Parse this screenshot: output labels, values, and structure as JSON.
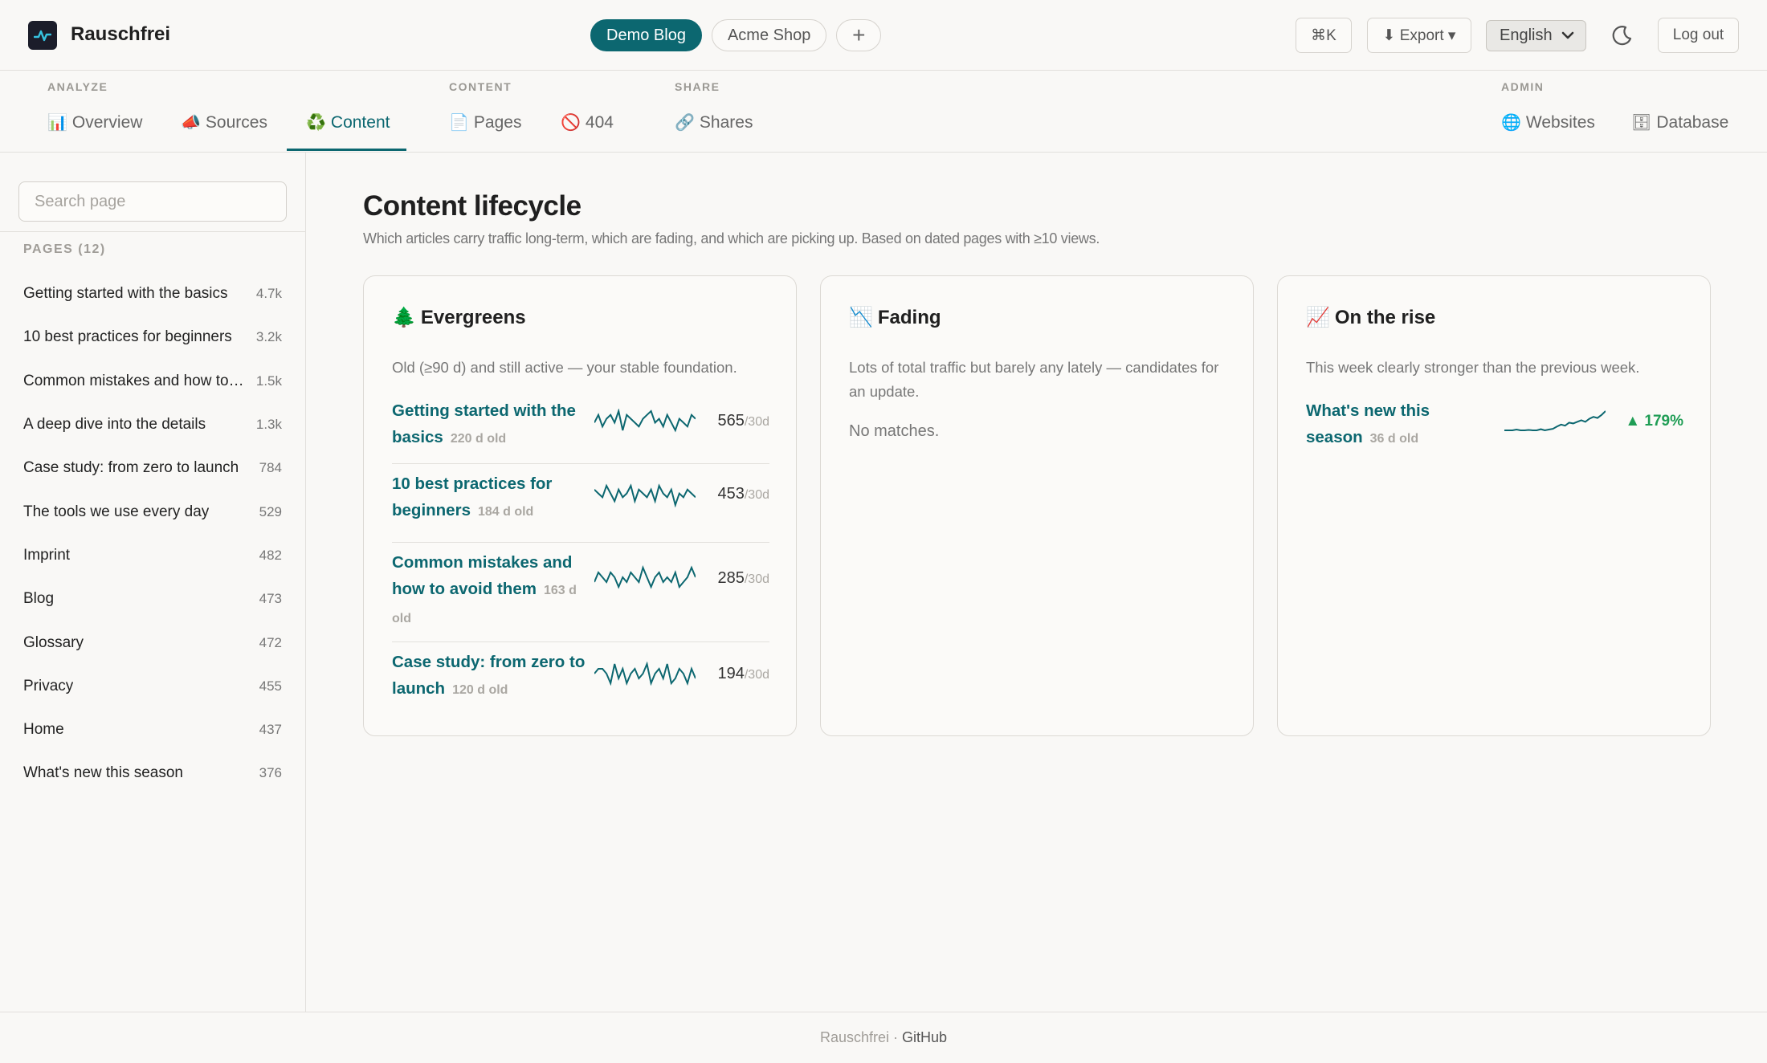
{
  "app": {
    "name": "Rauschfrei"
  },
  "workspaces": [
    {
      "label": "Demo Blog",
      "active": true
    },
    {
      "label": "Acme Shop",
      "active": false
    }
  ],
  "workspace_add": "+",
  "toolbar": {
    "command": "⌘K",
    "export": "⬇ Export ▾",
    "language": "English",
    "logout": "Log out"
  },
  "nav": {
    "groups": {
      "analyze": "ANALYZE",
      "content": "CONTENT",
      "share": "SHARE",
      "admin": "ADMIN"
    },
    "items": {
      "overview": {
        "icon": "📊",
        "label": "Overview"
      },
      "sources": {
        "icon": "📣",
        "label": "Sources"
      },
      "content": {
        "icon": "♻️",
        "label": "Content"
      },
      "pages": {
        "icon": "📄",
        "label": "Pages"
      },
      "notfound": {
        "icon": "🚫",
        "label": "404"
      },
      "shares": {
        "icon": "🔗",
        "label": "Shares"
      },
      "websites": {
        "icon": "🌐",
        "label": "Websites"
      },
      "database": {
        "icon": "🗄",
        "label": "Database"
      }
    },
    "active": "content"
  },
  "sidebar": {
    "search_placeholder": "Search page",
    "pages_label": "PAGES (12)",
    "pages": [
      {
        "title": "Getting started with the basics",
        "count": "4.7k"
      },
      {
        "title": "10 best practices for beginners",
        "count": "3.2k"
      },
      {
        "title": "Common mistakes and how to avoid them",
        "count": "1.5k"
      },
      {
        "title": "A deep dive into the details",
        "count": "1.3k"
      },
      {
        "title": "Case study: from zero to launch",
        "count": "784"
      },
      {
        "title": "The tools we use every day",
        "count": "529"
      },
      {
        "title": "Imprint",
        "count": "482"
      },
      {
        "title": "Blog",
        "count": "473"
      },
      {
        "title": "Glossary",
        "count": "472"
      },
      {
        "title": "Privacy",
        "count": "455"
      },
      {
        "title": "Home",
        "count": "437"
      },
      {
        "title": "What's new this season",
        "count": "376"
      }
    ]
  },
  "main": {
    "title": "Content lifecycle",
    "subtitle": "Which articles carry traffic long-term, which are fading, and which are picking up. Based on dated pages with ≥10 views."
  },
  "cards": {
    "evergreens": {
      "icon": "🌲",
      "title": "Evergreens",
      "desc": "Old (≥90 d) and still active — your stable foundation.",
      "rows": [
        {
          "title": "Getting started with the basics",
          "age": "220 d old",
          "views": "565",
          "per": "/30d",
          "spark": [
            4,
            6,
            3,
            5,
            6,
            4,
            7,
            2,
            6,
            5,
            4,
            3,
            5,
            6,
            7,
            4,
            5,
            3,
            6,
            4,
            2,
            5,
            4,
            3,
            6,
            5
          ]
        },
        {
          "title": "10 best practices for beginners",
          "age": "184 d old",
          "views": "453",
          "per": "/30d",
          "spark": [
            5,
            4,
            3,
            6,
            4,
            2,
            5,
            3,
            4,
            6,
            2,
            5,
            4,
            3,
            5,
            2,
            6,
            4,
            3,
            5,
            1,
            4,
            3,
            5,
            4,
            3
          ]
        },
        {
          "title": "Common mistakes and how to avoid them",
          "age": "163 d old",
          "views": "285",
          "per": "/30d",
          "spark": [
            3,
            5,
            4,
            3,
            5,
            4,
            2,
            4,
            3,
            5,
            4,
            3,
            6,
            4,
            2,
            4,
            5,
            3,
            4,
            3,
            5,
            2,
            3,
            4,
            6,
            4
          ]
        },
        {
          "title": "Case study: from zero to launch",
          "age": "120 d old",
          "views": "194",
          "per": "/30d",
          "spark": [
            4,
            5,
            5,
            4,
            2,
            6,
            3,
            5,
            2,
            4,
            5,
            3,
            4,
            6,
            2,
            4,
            5,
            3,
            6,
            2,
            3,
            5,
            4,
            2,
            5,
            3
          ]
        }
      ]
    },
    "fading": {
      "icon": "📉",
      "title": "Fading",
      "desc": "Lots of total traffic but barely any lately — candidates for an update.",
      "empty": "No matches."
    },
    "rising": {
      "icon": "📈",
      "title": "On the rise",
      "desc": "This week clearly stronger than the previous week.",
      "rows": [
        {
          "title": "What's new this season",
          "age": "36 d old",
          "change": "▲ 179%",
          "spark": [
            1,
            1,
            1,
            1.2,
            1,
            1,
            1.1,
            1,
            1,
            1.3,
            1,
            1.2,
            1.4,
            2,
            2.5,
            2.2,
            3,
            2.8,
            3.2,
            3.6,
            3.2,
            4,
            4.5,
            4.2,
            5,
            6
          ]
        }
      ]
    }
  },
  "footer": {
    "brand": "Rauschfrei ·",
    "link": "GitHub"
  },
  "colors": {
    "accent": "#0c6770",
    "positive": "#1f9d55"
  }
}
